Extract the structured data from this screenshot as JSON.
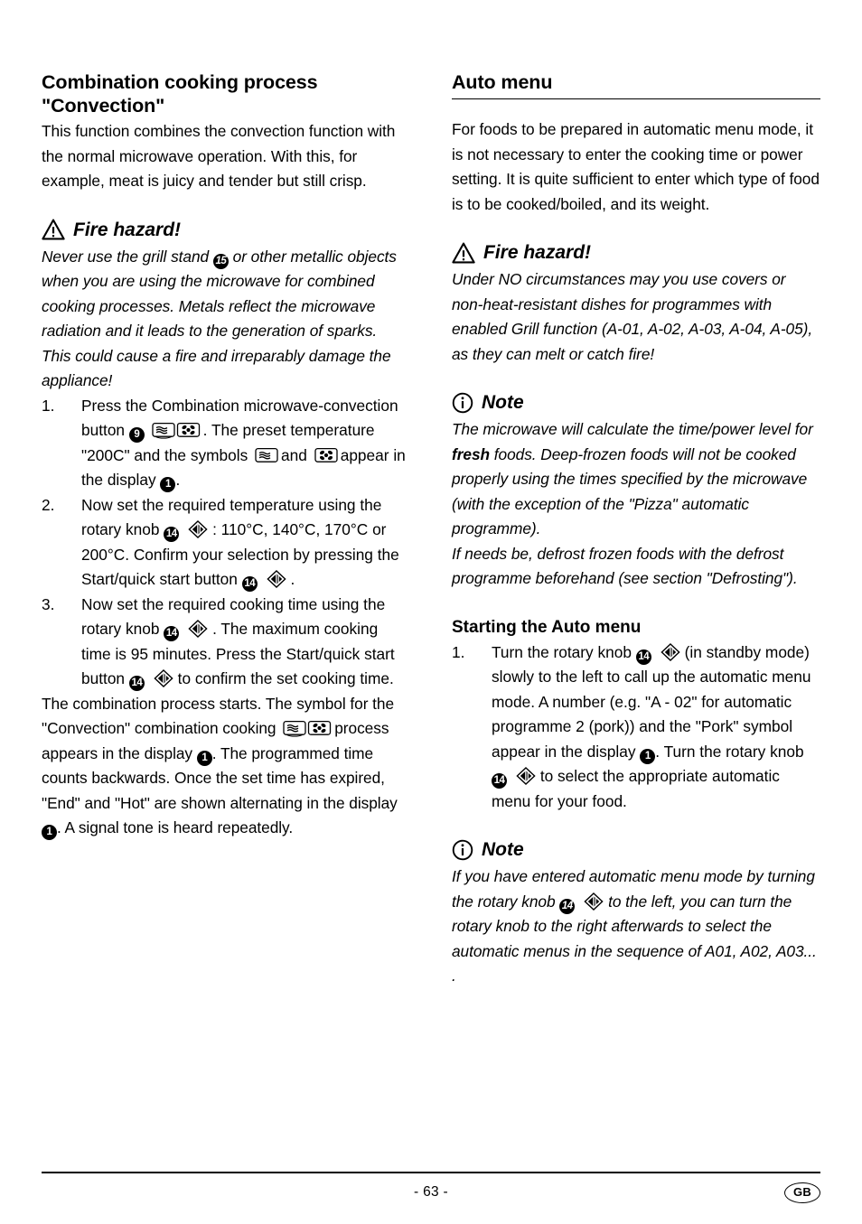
{
  "page": {
    "number_label": "- 63 -",
    "country_badge": "GB"
  },
  "left_column": {
    "heading": "Combination cooking process \"Convection\"",
    "intro": "This function combines the convection function with the normal microwave operation. With this, for example, meat is juicy and tender but still crisp.",
    "warning": {
      "icon": "warning-triangle-icon",
      "label": "Fire hazard!",
      "text": "Never use the grill stand ❶ or other metallic objects when you are using the microwave for combined cooking processes. Metals reflect the microwave radiation and it leads to the generation of sparks. This could cause a fire and irreparably damage the appliance!",
      "text_part1": "Never use the grill stand",
      "badge1": "15",
      "text_part2": "or other metallic objects when you are using the microwave for combined cooking processes. Metals reflect the microwave radiation and it leads to the generation of sparks. This could cause a fire and irreparably damage the appliance!"
    },
    "steps": [
      {
        "num": "1.",
        "p1": "Press the Combination microwave-convection button",
        "badge1": "9",
        "icon1": "microwave-convection-combination-icon",
        "p2": ". The preset temperature \"200C\" and the symbols",
        "icon2": "microwave-waves-icon",
        "p3": "and",
        "icon3": "convection-fan-icon",
        "p4": "appear in the display",
        "badge2": "1",
        "p5": "."
      },
      {
        "num": "2.",
        "p1": "Now set the required temperature using the rotary knob",
        "badge1": "14",
        "icon1": "rotary-knob-icon",
        "p2": ": 110°C, 140°C, 170°C or 200°C. Confirm your selection by pressing the Start/quick start button",
        "badge2": "14",
        "icon2": "rotary-knob-icon",
        "p3": "."
      },
      {
        "num": "3.",
        "p1": "Now set the required cooking time using the rotary knob",
        "badge1": "14",
        "icon1": "rotary-knob-icon",
        "p2": ". The maximum cooking time is 95 minutes. Press the Start/quick start button",
        "badge2": "14",
        "icon2": "rotary-knob-icon",
        "p3": "to confirm the set cooking time."
      }
    ],
    "closing": {
      "p1": "The combination process starts. The symbol for the \"Convection\" combination cooking",
      "icon1": "microwave-convection-combination-icon",
      "p2": "process appears in the display",
      "badge1": "1",
      "p3": ". The programmed time counts backwards. Once the set time has expired, \"End\" and \"Hot\" are shown alternating in the display",
      "badge2": "1",
      "p4": ". A signal tone is heard repeatedly."
    }
  },
  "right_column": {
    "heading": "Auto menu",
    "intro": "For foods to be prepared in automatic menu mode, it is not necessary to enter the cooking time or power setting. It is quite sufficient to enter which type of food is to be cooked/boiled, and its weight.",
    "warning": {
      "icon": "warning-triangle-icon",
      "label": "Fire hazard!",
      "text": "Under NO circumstances may you use covers or non-heat-resistant dishes for programmes with enabled Grill function (A-01, A-02, A-03, A-04, A-05), as they can melt or catch fire!"
    },
    "note1": {
      "icon": "info-circle-icon",
      "label": "Note",
      "p1": "The microwave will calculate the time/power level for",
      "bold": "fresh",
      "p2": "foods. Deep-frozen foods will not be cooked properly using the times specified by the microwave (with the exception of the \"Pizza\" automatic programme).",
      "p3": "If needs be, defrost frozen foods with the defrost programme beforehand (see section \"Defrosting\")."
    },
    "sub_heading": "Starting the Auto menu",
    "steps": [
      {
        "num": "1.",
        "p1": "Turn the rotary knob",
        "badge1": "14",
        "icon1": "rotary-knob-icon",
        "p2": "(in standby mode) slowly to the left to call up the automatic menu mode. A number (e.g. \"A - 02\" for automatic programme 2 (pork)) and the \"Pork\" symbol appear in the display",
        "badge2": "1",
        "p3": ". Turn the rotary knob",
        "badge3": "14",
        "icon2": "rotary-knob-icon",
        "p4": "to select the appropriate automatic menu for your food."
      }
    ],
    "note2": {
      "icon": "info-circle-icon",
      "label": "Note",
      "p1": "If you have entered automatic menu mode by turning the rotary knob",
      "badge1": "14",
      "icon1": "rotary-knob-icon",
      "p2": "to the left, you can turn the rotary knob to the right afterwards to select the automatic menus in the sequence of A01, A02, A03... ."
    }
  }
}
